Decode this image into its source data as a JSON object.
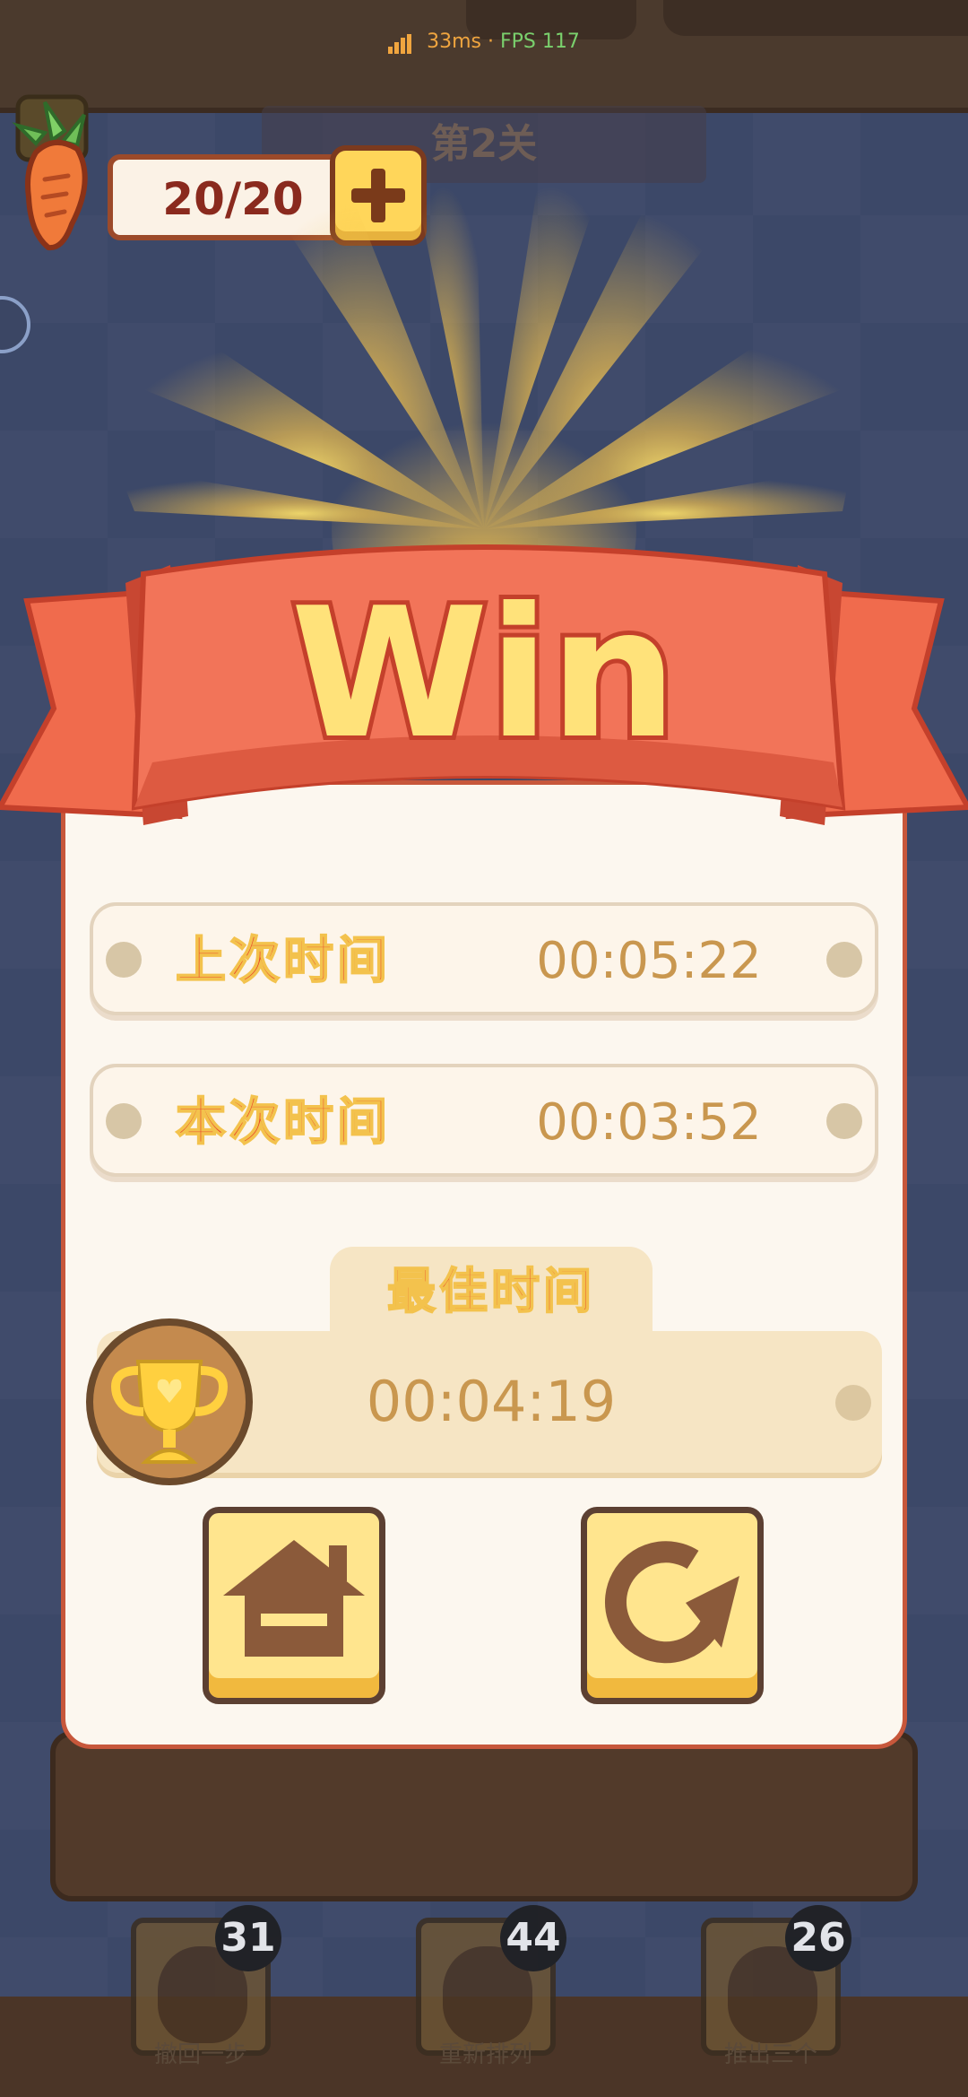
{
  "status_bar": {
    "ping": "33ms",
    "separator": "·",
    "fps": "FPS 117"
  },
  "level": {
    "title": "第2关"
  },
  "carrots": {
    "count": "20/20",
    "add_icon": "plus-icon",
    "icon": "carrot-icon"
  },
  "banner": {
    "text": "Win",
    "colors": {
      "ribbon": "#f06b4d",
      "text": "#ffe27a"
    }
  },
  "results": {
    "rows": [
      {
        "label": "上次时间",
        "time": "00:05:22"
      },
      {
        "label": "本次时间",
        "time": "00:03:52"
      }
    ],
    "best": {
      "label": "最佳时间",
      "time": "00:04:19",
      "icon": "trophy-icon"
    }
  },
  "actions": {
    "home": {
      "icon": "home-icon"
    },
    "restart": {
      "icon": "restart-icon"
    }
  },
  "tools": [
    {
      "label": "撤回一步",
      "count": "31",
      "icon": "bunny-undo-icon"
    },
    {
      "label": "重新排列",
      "count": "44",
      "icon": "bunny-shuffle-icon"
    },
    {
      "label": "推出三个",
      "count": "26",
      "icon": "bunny-hint-icon"
    }
  ]
}
